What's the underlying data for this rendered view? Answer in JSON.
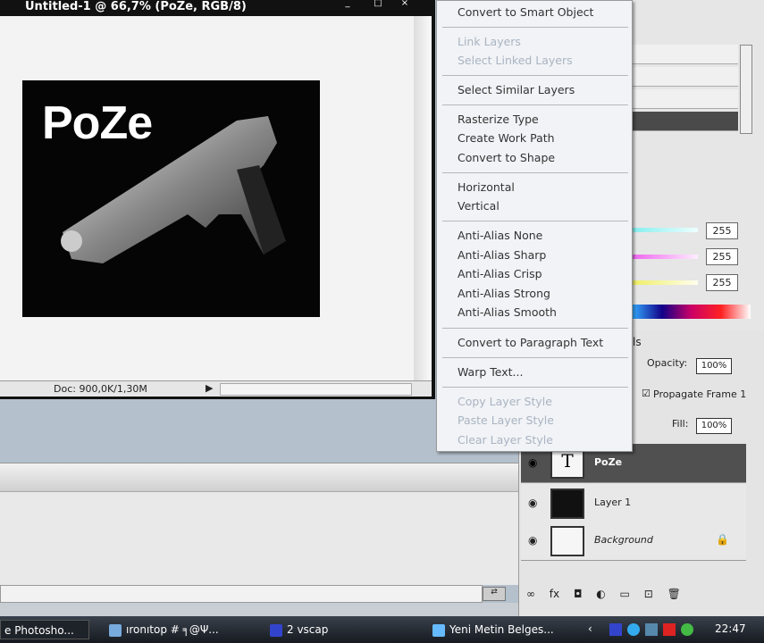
{
  "document": {
    "title": "Untitled-1 @ 66,7% (PoZe, RGB/8)",
    "canvas_text": "PoZe",
    "status": "Doc: 900,0K/1,30M"
  },
  "context_menu": {
    "items": [
      {
        "label": "Convert to Smart Object",
        "enabled": true
      },
      {
        "label": "Link Layers",
        "enabled": false
      },
      {
        "label": "Select Linked Layers",
        "enabled": false
      },
      {
        "label": "Select Similar Layers",
        "enabled": true
      },
      {
        "label": "Rasterize Type",
        "enabled": true
      },
      {
        "label": "Create Work Path",
        "enabled": true
      },
      {
        "label": "Convert to Shape",
        "enabled": true
      },
      {
        "label": "Horizontal",
        "enabled": true
      },
      {
        "label": "Vertical",
        "enabled": true
      },
      {
        "label": "Anti-Alias None",
        "enabled": true
      },
      {
        "label": "Anti-Alias Sharp",
        "enabled": true
      },
      {
        "label": "Anti-Alias Crisp",
        "enabled": true
      },
      {
        "label": "Anti-Alias Strong",
        "enabled": true
      },
      {
        "label": "Anti-Alias Smooth",
        "enabled": true
      },
      {
        "label": "Convert to Paragraph Text",
        "enabled": true
      },
      {
        "label": "Warp Text...",
        "enabled": true
      },
      {
        "label": "Copy Layer Style",
        "enabled": false
      },
      {
        "label": "Paste Layer Style",
        "enabled": false
      },
      {
        "label": "Clear Layer Style",
        "enabled": false
      }
    ]
  },
  "color_panel": {
    "values": [
      "255",
      "255",
      "255"
    ]
  },
  "layers_panel": {
    "tab_fragment": "ls",
    "opacity_label": "Opacity:",
    "opacity": "100%",
    "propagate_label": "Propagate Frame 1",
    "fill_label": "Fill:",
    "fill": "100%",
    "layers": [
      {
        "name": "PoZe",
        "type": "text",
        "selected": true
      },
      {
        "name": "Layer 1",
        "type": "image"
      },
      {
        "name": "Background",
        "type": "background",
        "locked": true
      }
    ]
  },
  "taskbar": {
    "items": [
      "e Photosho...",
      "ıronıtop # ╕@Ψ...",
      "2 vscap",
      "Yeni Metin Belges..."
    ],
    "clock": "22:47"
  }
}
